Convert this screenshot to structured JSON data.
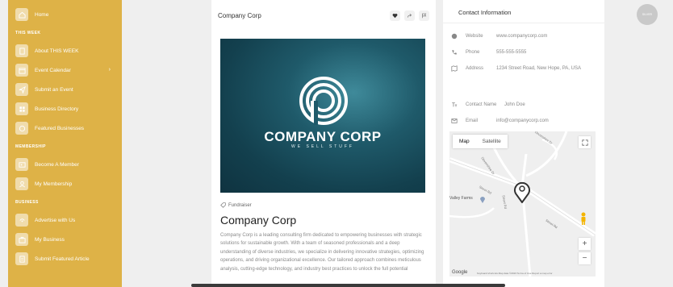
{
  "sidebar": {
    "home": "Home",
    "sections": {
      "this_week": "THIS WEEK",
      "membership": "MEMBERSHIP",
      "business": "BUSINESS"
    },
    "this_week_items": [
      {
        "label": "About THIS WEEK",
        "icon": "document-icon"
      },
      {
        "label": "Event Calendar",
        "icon": "calendar-icon"
      },
      {
        "label": "Submit an Event",
        "icon": "send-icon"
      },
      {
        "label": "Business Directory",
        "icon": "grid-icon"
      },
      {
        "label": "Featured Businesses",
        "icon": "star-icon"
      }
    ],
    "membership_items": [
      {
        "label": "Become A Member",
        "icon": "id-card-icon"
      },
      {
        "label": "My Membership",
        "icon": "user-icon"
      }
    ],
    "business_items": [
      {
        "label": "Advertise with Us",
        "icon": "broadcast-icon"
      },
      {
        "label": "My Business",
        "icon": "briefcase-icon"
      },
      {
        "label": "Submit Featured Article",
        "icon": "article-icon"
      }
    ]
  },
  "listing": {
    "header_title": "Company Corp",
    "logo_text": "COMPANY CORP",
    "logo_tagline": "WE SELL STUFF",
    "category": "Fundraiser",
    "name": "Company Corp",
    "description": "Company Corp is a leading consulting firm dedicated to empowering businesses with strategic solutions for sustainable growth. With a team of seasoned professionals and a deep understanding of diverse industries, we specialize in delivering innovative strategies, optimizing operations, and driving organizational excellence. Our tailored approach combines meticulous analysis, cutting-edge technology, and industry best practices to unlock the full potential"
  },
  "contact": {
    "title": "Contact Information",
    "website_label": "Website",
    "website": "www.companycorp.com",
    "phone_label": "Phone",
    "phone": "555-555-5555",
    "address_label": "Address",
    "address": "1234 Street Road, New Hope, PA, USA",
    "contact_name_label": "Contact Name",
    "contact_name": "John Doe",
    "email_label": "Email",
    "email": "info@companycorp.com"
  },
  "map": {
    "tab_map": "Map",
    "tab_satellite": "Satellite",
    "label_valley_farms": "Valley Farms",
    "label_street_rd_1": "Street Rd",
    "label_street_rd_2": "Street Rd",
    "label_street_rd_3": "Street Rd",
    "label_top_right": "Devonshire Dr",
    "label_left": "Devonshire Dr",
    "footer": "Keyboard shortcuts   Map data ©2023   Terms of Use   Report a map error",
    "google": "Google"
  },
  "badge": "SILVER",
  "colors": {
    "sidebar": "#deb247",
    "banner": "#13404e",
    "background": "#efefef"
  }
}
